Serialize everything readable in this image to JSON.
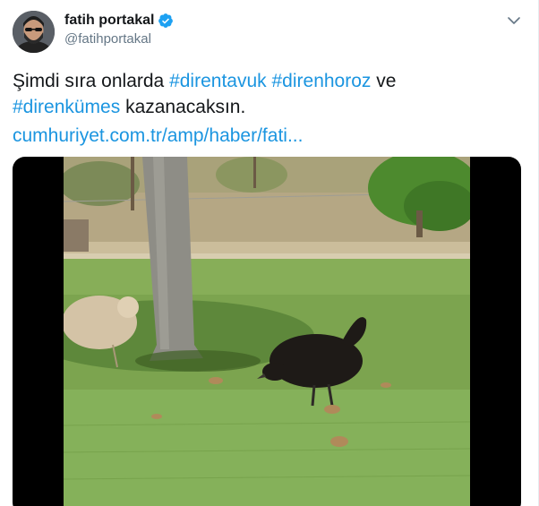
{
  "user": {
    "display_name": "fatih portakal",
    "handle": "@fatihportakal",
    "verified": true,
    "avatar_icon": "profile-photo"
  },
  "menu": {
    "icon": "chevron-down-icon"
  },
  "tweet": {
    "text_intro": "Şimdi sıra onlarda ",
    "hashtag_1": "#direntavuk",
    "space_1": " ",
    "hashtag_2": "#direnhoroz",
    "text_ve": " ve",
    "hashtag_3": "#direnkümes",
    "text_end": " kazanacaksın.",
    "link": "cumhuriyet.com.tr/amp/haber/fati..."
  },
  "media": {
    "type": "video",
    "description_icon": "video-thumbnail"
  },
  "colors": {
    "link": "#1b95e0",
    "text": "#14171a",
    "secondary": "#657786",
    "verified": "#1da1f2"
  }
}
